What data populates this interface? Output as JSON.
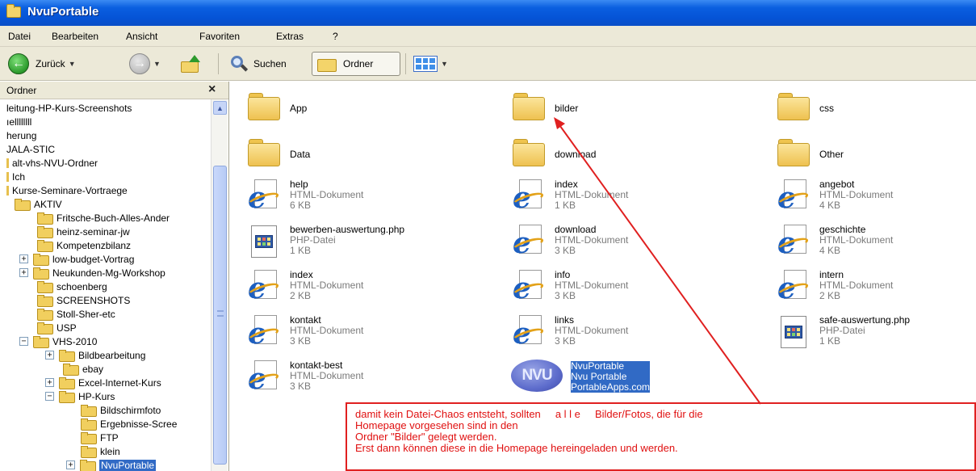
{
  "window": {
    "title": "NvuPortable"
  },
  "menu": [
    "Datei",
    "Bearbeiten",
    "Ansicht",
    "Favoriten",
    "Extras",
    "?"
  ],
  "toolbar": {
    "back_label": "Zurück",
    "search_label": "Suchen",
    "folders_label": "Ordner"
  },
  "left_pane": {
    "title": "Ordner",
    "tree": [
      {
        "label": "leitung-HP-Kurs-Screenshots",
        "level": 0
      },
      {
        "label": "ıellllllll",
        "level": 0
      },
      {
        "label": "herung",
        "level": 0
      },
      {
        "label": "JALA-STIC",
        "level": 0
      },
      {
        "label": "alt-vhs-NVU-Ordner",
        "level": 0,
        "prefix": "▯"
      },
      {
        "label": "Ich",
        "level": 0,
        "prefix": "▯"
      },
      {
        "label": "Kurse-Seminare-Vortraege",
        "level": 0,
        "prefix": "▯"
      },
      {
        "label": "AKTIV",
        "level": 1,
        "folder": true
      },
      {
        "label": "Fritsche-Buch-Alles-Ander",
        "level": 2,
        "folder": true
      },
      {
        "label": "heinz-seminar-jw",
        "level": 2,
        "folder": true
      },
      {
        "label": "Kompetenzbilanz",
        "level": 2,
        "folder": true
      },
      {
        "label": "low-budget-Vortrag",
        "level": 2,
        "folder": true,
        "expander": "+"
      },
      {
        "label": "Neukunden-Mg-Workshop",
        "level": 2,
        "folder": true,
        "expander": "+"
      },
      {
        "label": "schoenberg",
        "level": 2,
        "folder": true
      },
      {
        "label": "SCREENSHOTS",
        "level": 2,
        "folder": true
      },
      {
        "label": "Stoll-Sher-etc",
        "level": 2,
        "folder": true
      },
      {
        "label": "USP",
        "level": 2,
        "folder": true
      },
      {
        "label": "VHS-2010",
        "level": 2,
        "folder": true,
        "expander": "−"
      },
      {
        "label": "Bildbearbeitung",
        "level": 3,
        "folder": true,
        "expander": "+"
      },
      {
        "label": "ebay",
        "level": 3,
        "folder": true
      },
      {
        "label": "Excel-Internet-Kurs",
        "level": 3,
        "folder": true,
        "expander": "+"
      },
      {
        "label": "HP-Kurs",
        "level": 3,
        "folder": true,
        "expander": "−"
      },
      {
        "label": "Bildschirmfoto",
        "level": 4,
        "folder": true
      },
      {
        "label": "Ergebnisse-Scree",
        "level": 4,
        "folder": true
      },
      {
        "label": "FTP",
        "level": 4,
        "folder": true
      },
      {
        "label": "klein",
        "level": 4,
        "folder": true
      },
      {
        "label": "NvuPortable",
        "level": 4,
        "folder": true,
        "expander": "+",
        "selected": true
      }
    ]
  },
  "files": [
    {
      "name": "App",
      "kind": "folder",
      "col": 0,
      "row": 0
    },
    {
      "name": "bilder",
      "kind": "folder",
      "col": 1,
      "row": 0
    },
    {
      "name": "css",
      "kind": "folder",
      "col": 2,
      "row": 0
    },
    {
      "name": "Data",
      "kind": "folder",
      "col": 0,
      "row": 1
    },
    {
      "name": "download",
      "kind": "folder",
      "col": 1,
      "row": 1
    },
    {
      "name": "Other",
      "kind": "folder",
      "col": 2,
      "row": 1
    },
    {
      "name": "help",
      "type": "HTML-Dokument",
      "size": "6 KB",
      "kind": "html",
      "col": 0,
      "row": 2
    },
    {
      "name": "index",
      "type": "HTML-Dokument",
      "size": "1 KB",
      "kind": "html",
      "col": 1,
      "row": 2
    },
    {
      "name": "angebot",
      "type": "HTML-Dokument",
      "size": "4 KB",
      "kind": "html",
      "col": 2,
      "row": 2
    },
    {
      "name": "bewerben-auswertung.php",
      "type": "PHP-Datei",
      "size": "1 KB",
      "kind": "php",
      "col": 0,
      "row": 3
    },
    {
      "name": "download",
      "type": "HTML-Dokument",
      "size": "3 KB",
      "kind": "html",
      "col": 1,
      "row": 3
    },
    {
      "name": "geschichte",
      "type": "HTML-Dokument",
      "size": "4 KB",
      "kind": "html",
      "col": 2,
      "row": 3
    },
    {
      "name": "index",
      "type": "HTML-Dokument",
      "size": "2 KB",
      "kind": "html",
      "col": 0,
      "row": 4
    },
    {
      "name": "info",
      "type": "HTML-Dokument",
      "size": "3 KB",
      "kind": "html",
      "col": 1,
      "row": 4
    },
    {
      "name": "intern",
      "type": "HTML-Dokument",
      "size": "2 KB",
      "kind": "html",
      "col": 2,
      "row": 4
    },
    {
      "name": "kontakt",
      "type": "HTML-Dokument",
      "size": "3 KB",
      "kind": "html",
      "col": 0,
      "row": 5
    },
    {
      "name": "links",
      "type": "HTML-Dokument",
      "size": "3 KB",
      "kind": "html",
      "col": 1,
      "row": 5
    },
    {
      "name": "safe-auswertung.php",
      "type": "PHP-Datei",
      "size": "1 KB",
      "kind": "php",
      "col": 2,
      "row": 5
    },
    {
      "name": "kontakt-best",
      "type": "HTML-Dokument",
      "size": "3 KB",
      "kind": "html",
      "col": 0,
      "row": 6
    },
    {
      "name": "NvuPortable",
      "type": "Nvu Portable",
      "size": "PortableApps.com",
      "kind": "nvu",
      "col": 1,
      "row": 6,
      "selected": true,
      "logo_text": "NVU"
    }
  ],
  "annotation": {
    "lines": [
      "damit kein Datei-Chaos entsteht, sollten     a l l e     Bilder/Fotos, die für die",
      "Homepage vorgesehen sind in den",
      "Ordner \"Bilder\" gelegt werden.",
      "Erst dann können diese in die Homepage hereingeladen und werden."
    ],
    "color": "#e01010"
  },
  "colors": {
    "titlebar": "#0553d6",
    "chrome": "#ece9d8",
    "selection": "#316ac5"
  }
}
